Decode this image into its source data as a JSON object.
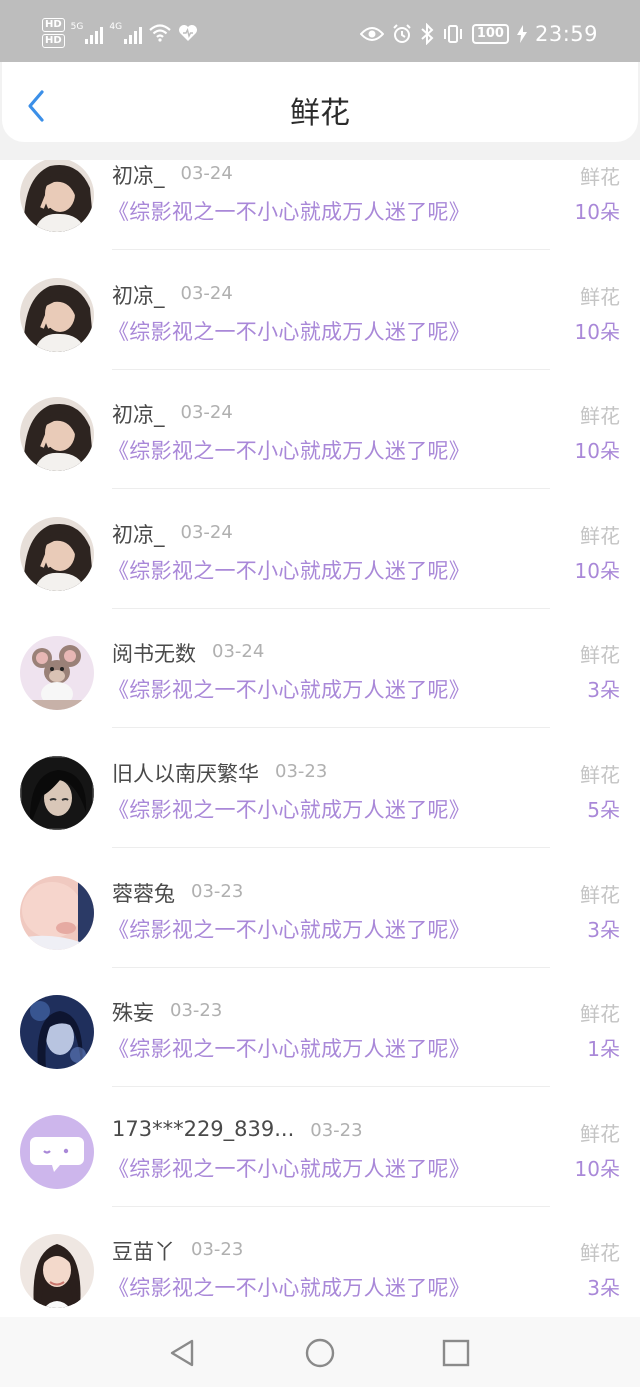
{
  "status_bar": {
    "hd_labels": [
      "HD",
      "HD"
    ],
    "signal1_label": "5G",
    "signal2_label": "4G",
    "battery": "100",
    "time": "23:59",
    "icons": [
      "eye-icon",
      "alarm-icon",
      "bluetooth-icon",
      "vibrate-icon",
      "battery-icon",
      "charging-icon"
    ]
  },
  "header": {
    "title": "鲜花",
    "back_icon": "chevron-left-icon"
  },
  "colors": {
    "accent": "#a988d8",
    "status_bar": "#bdbdbd",
    "back_icon": "#3b8fe8"
  },
  "list": {
    "items": [
      {
        "name": "初凉_",
        "date": "03-24",
        "book": "《综影视之一不小心就成万人迷了呢》",
        "gift": "鲜花",
        "count": "10朵",
        "avatar": "girl-curly-hair"
      },
      {
        "name": "初凉_",
        "date": "03-24",
        "book": "《综影视之一不小心就成万人迷了呢》",
        "gift": "鲜花",
        "count": "10朵",
        "avatar": "girl-curly-hair"
      },
      {
        "name": "初凉_",
        "date": "03-24",
        "book": "《综影视之一不小心就成万人迷了呢》",
        "gift": "鲜花",
        "count": "10朵",
        "avatar": "girl-curly-hair"
      },
      {
        "name": "初凉_",
        "date": "03-24",
        "book": "《综影视之一不小心就成万人迷了呢》",
        "gift": "鲜花",
        "count": "10朵",
        "avatar": "girl-curly-hair"
      },
      {
        "name": "阅书无数",
        "date": "03-24",
        "book": "《综影视之一不小心就成万人迷了呢》",
        "gift": "鲜花",
        "count": "3朵",
        "avatar": "cartoon-mouse"
      },
      {
        "name": "旧人以南厌繁华",
        "date": "03-23",
        "book": "《综影视之一不小心就成万人迷了呢》",
        "gift": "鲜花",
        "count": "5朵",
        "avatar": "dark-hair-man"
      },
      {
        "name": "蓉蓉兔",
        "date": "03-23",
        "book": "《综影视之一不小心就成万人迷了呢》",
        "gift": "鲜花",
        "count": "3朵",
        "avatar": "baby-face"
      },
      {
        "name": "殊妄",
        "date": "03-23",
        "book": "《综影视之一不小心就成万人迷了呢》",
        "gift": "鲜花",
        "count": "1朵",
        "avatar": "blue-portrait"
      },
      {
        "name": "173***229_839...",
        "date": "03-23",
        "book": "《综影视之一不小心就成万人迷了呢》",
        "gift": "鲜花",
        "count": "10朵",
        "avatar": "default-chat-bubble"
      },
      {
        "name": "豆苗丫",
        "date": "03-23",
        "book": "《综影视之一不小心就成万人迷了呢》",
        "gift": "鲜花",
        "count": "3朵",
        "avatar": "girl-braids"
      }
    ]
  },
  "system_nav": {
    "buttons": [
      "back-triangle-icon",
      "home-circle-icon",
      "recents-square-icon"
    ]
  }
}
